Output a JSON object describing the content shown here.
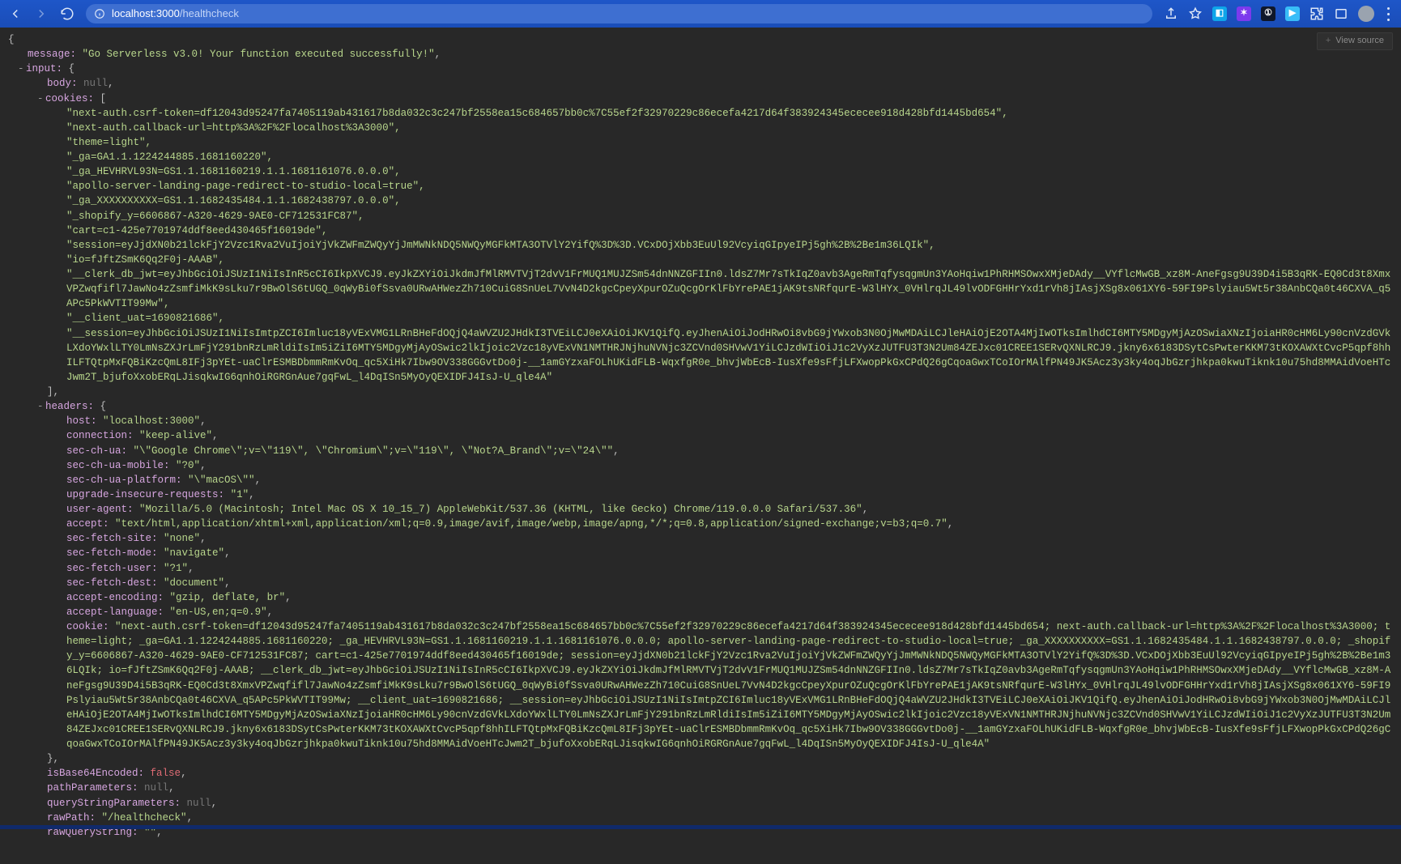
{
  "browser": {
    "url_host": "localhost:3000",
    "url_path": "/healthcheck",
    "back_icon": "arrow-left-icon",
    "forward_icon": "arrow-right-icon",
    "reload_icon": "reload-icon",
    "info_icon": "info-icon",
    "share_icon": "share-icon",
    "star_icon": "star-icon",
    "extensions": [
      "ext-sky",
      "ext-violet",
      "ext-dark",
      "ext-blue"
    ],
    "puzzle_icon": "puzzle-icon",
    "window_icon": "window-icon",
    "profile_icon": "profile-avatar",
    "menu_icon": "kebab-menu-icon",
    "view_source_label": "View source"
  },
  "json": {
    "message": "\"Go Serverless v3.0! Your function executed successfully!\"",
    "input_label": "input:",
    "body_key": "body:",
    "body_val": "null",
    "cookies_key": "cookies:",
    "cookies_open": "[",
    "cookies": [
      "\"next-auth.csrf-token=df12043d95247fa7405119ab431617b8da032c3c247bf2558ea15c684657bb0c%7C55ef2f32970229c86ecefa4217d64f383924345ececee918d428bfd1445bd654\",",
      "\"next-auth.callback-url=http%3A%2F%2Flocalhost%3A3000\",",
      "\"theme=light\",",
      "\"_ga=GA1.1.1224244885.1681160220\",",
      "\"_ga_HEVHRVL93N=GS1.1.1681160219.1.1.1681161076.0.0.0\",",
      "\"apollo-server-landing-page-redirect-to-studio-local=true\",",
      "\"_ga_XXXXXXXXXX=GS1.1.1682435484.1.1.1682438797.0.0.0\",",
      "\"_shopify_y=6606867-A320-4629-9AE0-CF712531FC87\",",
      "\"cart=c1-425e7701974ddf8eed430465f16019de\",",
      "\"session=eyJjdXN0b21lckFjY2Vzc1Rva2VuIjoiYjVkZWFmZWQyYjJmMWNkNDQ5NWQyMGFkMTA3OTVlY2YifQ%3D%3D.VCxDOjXbb3EuUl92VcyiqGIpyeIPj5gh%2B%2Be1m36LQIk\",",
      "\"io=fJftZSmK6Qq2F0j-AAAB\","
    ],
    "clerk_db_jwt": [
      "\"__clerk_db_jwt=eyJhbGciOiJSUzI1NiIsInR5cCI6IkpXVCJ9.eyJkZXYiOiJkdmJfMlRMVTVjT2dvV1FrMUQ1MUJZSm54dnNNZGFIIn0.ldsZ7Mr7sTkIqZ0avb3AgeRmTqfysqgmUn3YAoHqiw1PhRHMSOwxXMjeDAdy__VYflcMwGB_xz8M-AneFgsg9U39D4i5B3qRK-EQ0Cd3t8XmxVPZwqfifl7JawNo4zZsmfiMkK9sLku7r9BwOlS6tUGQ_0qWyBi0fSsva0URwAHWezZh710CuiG8SnUeL7VvN4D2kgcCpeyXpurOZuQcgOrKlFbYrePAE1jAK9tsNRfqurE-W3lHYx_0VHlrqJL49lvODFGHHrYxd1rVh8jIAsjXSg8x061XY6-59FI9Pslyiau5Wt5r38AnbCQa0t46CXVA_q5APc5PkWVTIT99Mw\","
    ],
    "client_uat": "\"__client_uat=1690821686\",",
    "session_jwt": [
      "\"__session=eyJhbGciOiJSUzI1NiIsImtpZCI6Imluc18yVExVMG1LRnBHeFdOQjQ4aWVZU2JHdkI3TVEiLCJ0eXAiOiJKV1QifQ.eyJhenAiOiJodHRwOi8vbG9jYWxob3N0OjMwMDAiLCJleHAiOjE2OTA4MjIwOTksImlhdCI6MTY5MDgyMjAzOSwiaXNzIjoiaHR0cHM6Ly90cnVzdGVkLXdoYWxlLTY0LmNsZXJrLmFjY291bnRzLmRldiIsIm5iZiI6MTY5MDgyMjAyOSwic2lkIjoic2Vzc18yVExVN1NMTHRJNjhuNVNjc3ZCVnd0SHVwV1YiLCJzdWIiOiJ1c2VyXzJUTFU3T3N2Um84ZEJxc01CREE1SERvQXNLRCJ9.jkny6x6183DSytCsPwterKKM73tKOXAWXtCvcP5qpf8hhILFTQtpMxFQBiKzcQmL8IFj3pYEt-uaClrESMBDbmmRmKvOq_qc5XiHk7Ibw9OV338GGGvtDo0j-__1amGYzxaFOLhUKidFLB-WqxfgR0e_bhvjWbEcB-IusXfe9sFfjLFXwopPkGxCPdQ26gCqoaGwxTCoIOrMAlfPN49JK5Acz3y3ky4oqJbGzrjhkpa0kwuTiknk10u75hd8MMAidVoeHTcJwm2T_bjufoXxobERqLJisqkwIG6qnhOiRGRGnAue7gqFwL_l4DqISn5MyOyQEXIDFJ4IsJ-U_qle4A\""
    ],
    "cookies_close": "],",
    "headers_label": "headers:",
    "headers": {
      "host": "\"localhost:3000\"",
      "connection": "\"keep-alive\"",
      "sec_ch_ua": "\"\\\"Google Chrome\\\";v=\\\"119\\\", \\\"Chromium\\\";v=\\\"119\\\", \\\"Not?A_Brand\\\";v=\\\"24\\\"\"",
      "sec_ch_ua_mobile": "\"?0\"",
      "sec_ch_ua_platform": "\"\\\"macOS\\\"\"",
      "upgrade_insecure_requests": "\"1\"",
      "user_agent": "\"Mozilla/5.0 (Macintosh; Intel Mac OS X 10_15_7) AppleWebKit/537.36 (KHTML, like Gecko) Chrome/119.0.0.0 Safari/537.36\"",
      "accept": "\"text/html,application/xhtml+xml,application/xml;q=0.9,image/avif,image/webp,image/apng,*/*;q=0.8,application/signed-exchange;v=b3;q=0.7\"",
      "sec_fetch_site": "\"none\"",
      "sec_fetch_mode": "\"navigate\"",
      "sec_fetch_user": "\"?1\"",
      "sec_fetch_dest": "\"document\"",
      "accept_encoding": "\"gzip, deflate, br\"",
      "accept_language": "\"en-US,en;q=0.9\""
    },
    "header_keys": {
      "host": "host:",
      "connection": "connection:",
      "sec_ch_ua": "sec-ch-ua:",
      "sec_ch_ua_mobile": "sec-ch-ua-mobile:",
      "sec_ch_ua_platform": "sec-ch-ua-platform:",
      "upgrade_insecure_requests": "upgrade-insecure-requests:",
      "user_agent": "user-agent:",
      "accept": "accept:",
      "sec_fetch_site": "sec-fetch-site:",
      "sec_fetch_mode": "sec-fetch-mode:",
      "sec_fetch_user": "sec-fetch-user:",
      "sec_fetch_dest": "sec-fetch-dest:",
      "accept_encoding": "accept-encoding:",
      "accept_language": "accept-language:",
      "cookie": "cookie:"
    },
    "cookie_header": [
      "\"next-auth.csrf-token=df12043d95247fa7405119ab431617b8da032c3c247bf2558ea15c684657bb0c%7C55ef2f32970229c86ecefa4217d64f383924345ececee918d428bfd1445bd654; next-auth.callback-url=http%3A%2F%2Flocalhost%3A3000; theme=light; _ga=GA1.1.1224244885.1681160220; _ga_HEVHRVL93N=GS1.1.1681160219.1.1.1681161076.0.0.0; apollo-server-landing-page-redirect-to-studio-local=true; _ga_XXXXXXXXXX=GS1.1.1682435484.1.1.1682438797.0.0.0; _shopify_y=6606867-A320-4629-9AE0-CF712531FC87; cart=c1-425e7701974ddf8eed430465f16019de; session=eyJjdXN0b21lckFjY2Vzc1Rva2VuIjoiYjVkZWFmZWQyYjJmMWNkNDQ5NWQyMGFkMTA3OTVlY2YifQ%3D%3D.VCxDOjXbb3EuUl92VcyiqGIpyeIPj5gh%2B%2Be1m36LQIk; io=fJftZSmK6Qq2F0j-AAAB; __clerk_db_jwt=eyJhbGciOiJSUzI1NiIsInR5cCI6IkpXVCJ9.eyJkZXYiOiJkdmJfMlRMVTVjT2dvV1FrMUQ1MUJZSm54dnNNZGFIIn0.ldsZ7Mr7sTkIqZ0avb3AgeRmTqfysqgmUn3YAoHqiw1PhRHMSOwxXMjeDAdy__VYflcMwGB_xz8M-AneFgsg9U39D4i5B3qRK-EQ0Cd3t8XmxVPZwqfifl7JawNo4zZsmfiMkK9sLku7r9BwOlS6tUGQ_0qWyBi0fSsva0URwAHWezZh710CuiG8SnUeL7VvN4D2kgcCpeyXpurOZuQcgOrKlFbYrePAE1jAK9tsNRfqurE-W3lHYx_0VHlrqJL49lvODFGHHrYxd1rVh8jIAsjXSg8x061XY6-59FI9Pslyiau5Wt5r38AnbCQa0t46CXVA_q5APc5PkWVTIT99Mw; __client_uat=1690821686; __session=eyJhbGciOiJSUzI1NiIsImtpZCI6Imluc18yVExVMG1LRnBHeFdOQjQ4aWVZU2JHdkI3TVEiLCJ0eXAiOiJKV1QifQ.eyJhenAiOiJodHRwOi8vbG9jYWxob3N0OjMwMDAiLCJleHAiOjE2OTA4MjIwOTksImlhdCI6MTY5MDgyMjAzOSwiaXNzIjoiaHR0cHM6Ly90cnVzdGVkLXdoYWxlLTY0LmNsZXJrLmFjY291bnRzLmRldiIsIm5iZiI6MTY5MDgyMjAyOSwic2lkIjoic2Vzc18yVExVN1NMTHRJNjhuNVNjc3ZCVnd0SHVwV1YiLCJzdWIiOiJ1c2VyXzJUTFU3T3N2Um84ZEJxc01CREE1SERvQXNLRCJ9.jkny6x6183DSytCsPwterKKM73tKOXAWXtCvcP5qpf8hhILFTQtpMxFQBiKzcQmL8IFj3pYEt-uaClrESMBDbmmRmKvOq_qc5XiHk7Ibw9OV338GGGvtDo0j-__1amGYzxaFOLhUKidFLB-WqxfgR0e_bhvjWbEcB-IusXfe9sFfjLFXwopPkGxCPdQ26gCqoaGwxTCoIOrMAlfPN49JK5Acz3y3ky4oqJbGzrjhkpa0kwuTiknk10u75hd8MMAidVoeHTcJwm2T_bjufoXxobERqLJisqkwIG6qnhOiRGRGnAue7gqFwL_l4DqISn5MyOyQEXIDFJ4IsJ-U_qle4A\""
    ],
    "headers_close": "},",
    "tail": {
      "isBase64Encoded_key": "isBase64Encoded:",
      "isBase64Encoded_val": "false",
      "pathParameters_key": "pathParameters:",
      "pathParameters_val": "null",
      "queryStringParameters_key": "queryStringParameters:",
      "queryStringParameters_val": "null",
      "rawPath_key": "rawPath:",
      "rawPath_val": "\"/healthcheck\"",
      "rawQueryString_key": "rawQueryString:",
      "rawQueryString_val": "\"\""
    },
    "labels": {
      "message_key": "message:",
      "open_brace": "{",
      "close_brace": "}",
      "collapse": "-"
    }
  }
}
